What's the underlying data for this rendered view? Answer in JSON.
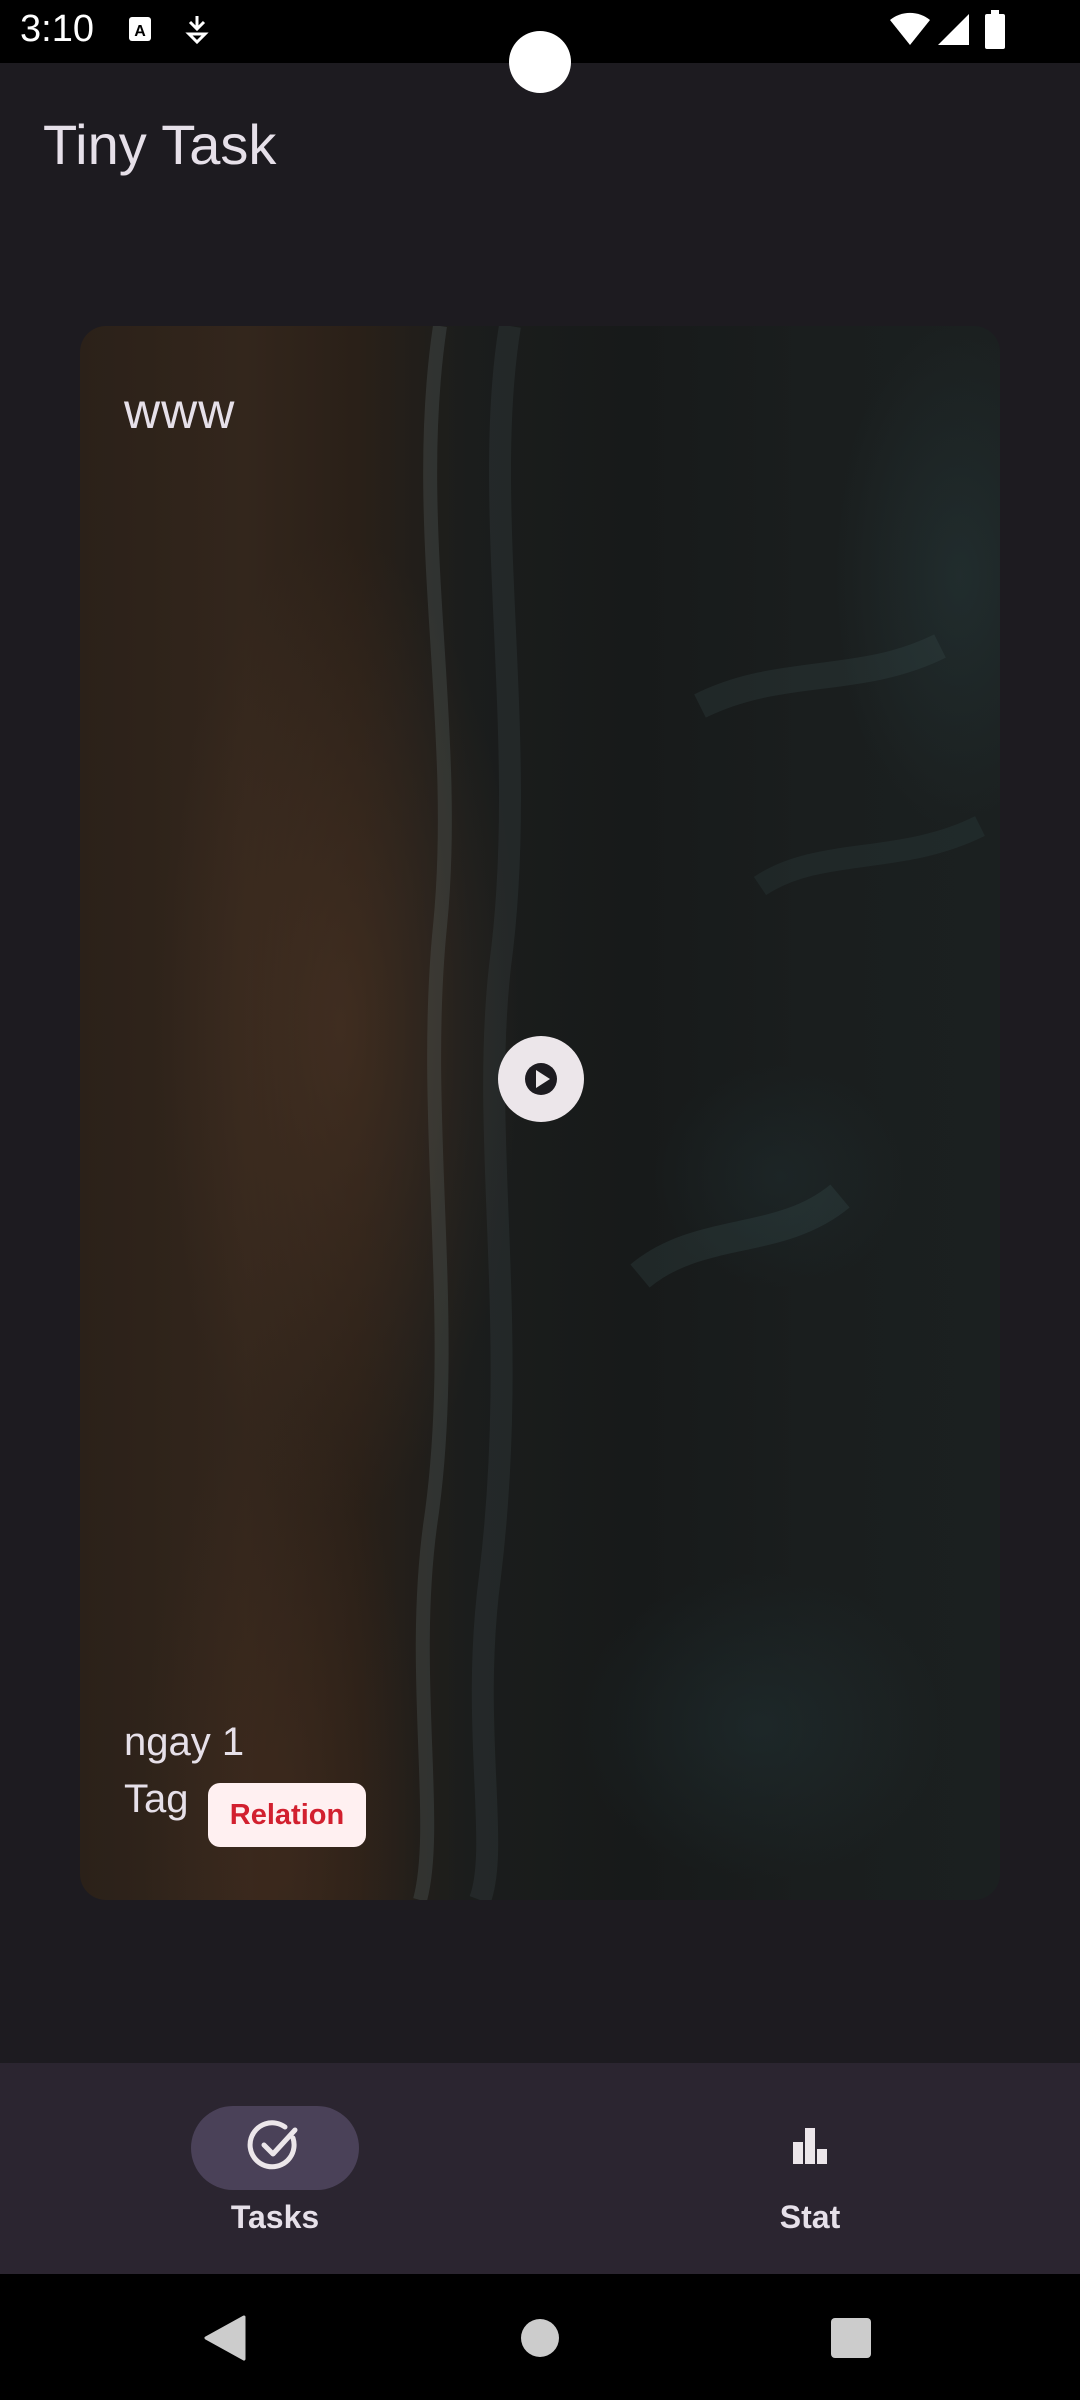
{
  "status_bar": {
    "time": "3:10",
    "icons": [
      "a-badge-icon",
      "download-arrow-icon",
      "wifi-icon",
      "signal-icon",
      "battery-icon"
    ]
  },
  "app": {
    "title": "Tiny Task"
  },
  "card": {
    "title": "www",
    "date": "ngay 1",
    "tag_label": "Tag",
    "tag_chip": "Relation",
    "media": "aerial beach video background",
    "play_icon": "play-icon"
  },
  "bottom_nav": {
    "items": [
      {
        "label": "Tasks",
        "icon": "check-circle-icon",
        "selected": true
      },
      {
        "label": "Stat",
        "icon": "bar-chart-icon",
        "selected": false
      }
    ]
  },
  "system_nav": {
    "icons": [
      "back-icon",
      "home-icon",
      "recents-icon"
    ]
  },
  "colors": {
    "background": "#1d1b20",
    "nav_bar": "#2b2530",
    "nav_indicator": "#4a4158",
    "chip_bg": "#fff0f1",
    "chip_text": "#d2202f"
  }
}
